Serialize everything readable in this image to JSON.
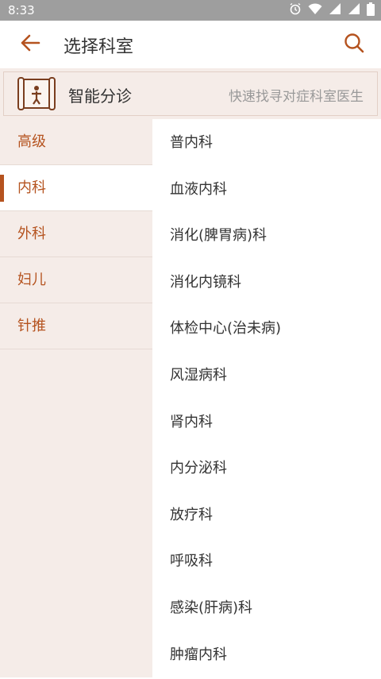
{
  "status_bar": {
    "time": "8:33"
  },
  "app_bar": {
    "title": "选择科室"
  },
  "triage": {
    "label": "智能分诊",
    "hint": "快速找寻对症科室医生"
  },
  "categories": [
    "高级",
    "内科",
    "外科",
    "妇儿",
    "针推"
  ],
  "active_category_index": 1,
  "departments": [
    "普内科",
    "血液内科",
    "消化(脾胃病)科",
    "消化内镜科",
    "体检中心(治未病)",
    "风湿病科",
    "肾内科",
    "内分泌科",
    "放疗科",
    "呼吸科",
    "感染(肝病)科",
    "肿瘤内科"
  ],
  "colors": {
    "accent": "#b5531f",
    "sidebar_bg": "#f5ece8",
    "status_bar": "#9e9e9e"
  },
  "icons": [
    "alarm-icon",
    "wifi-icon",
    "signal-icon",
    "battery-icon",
    "back-arrow-icon",
    "search-icon",
    "triage-scroll-icon"
  ]
}
